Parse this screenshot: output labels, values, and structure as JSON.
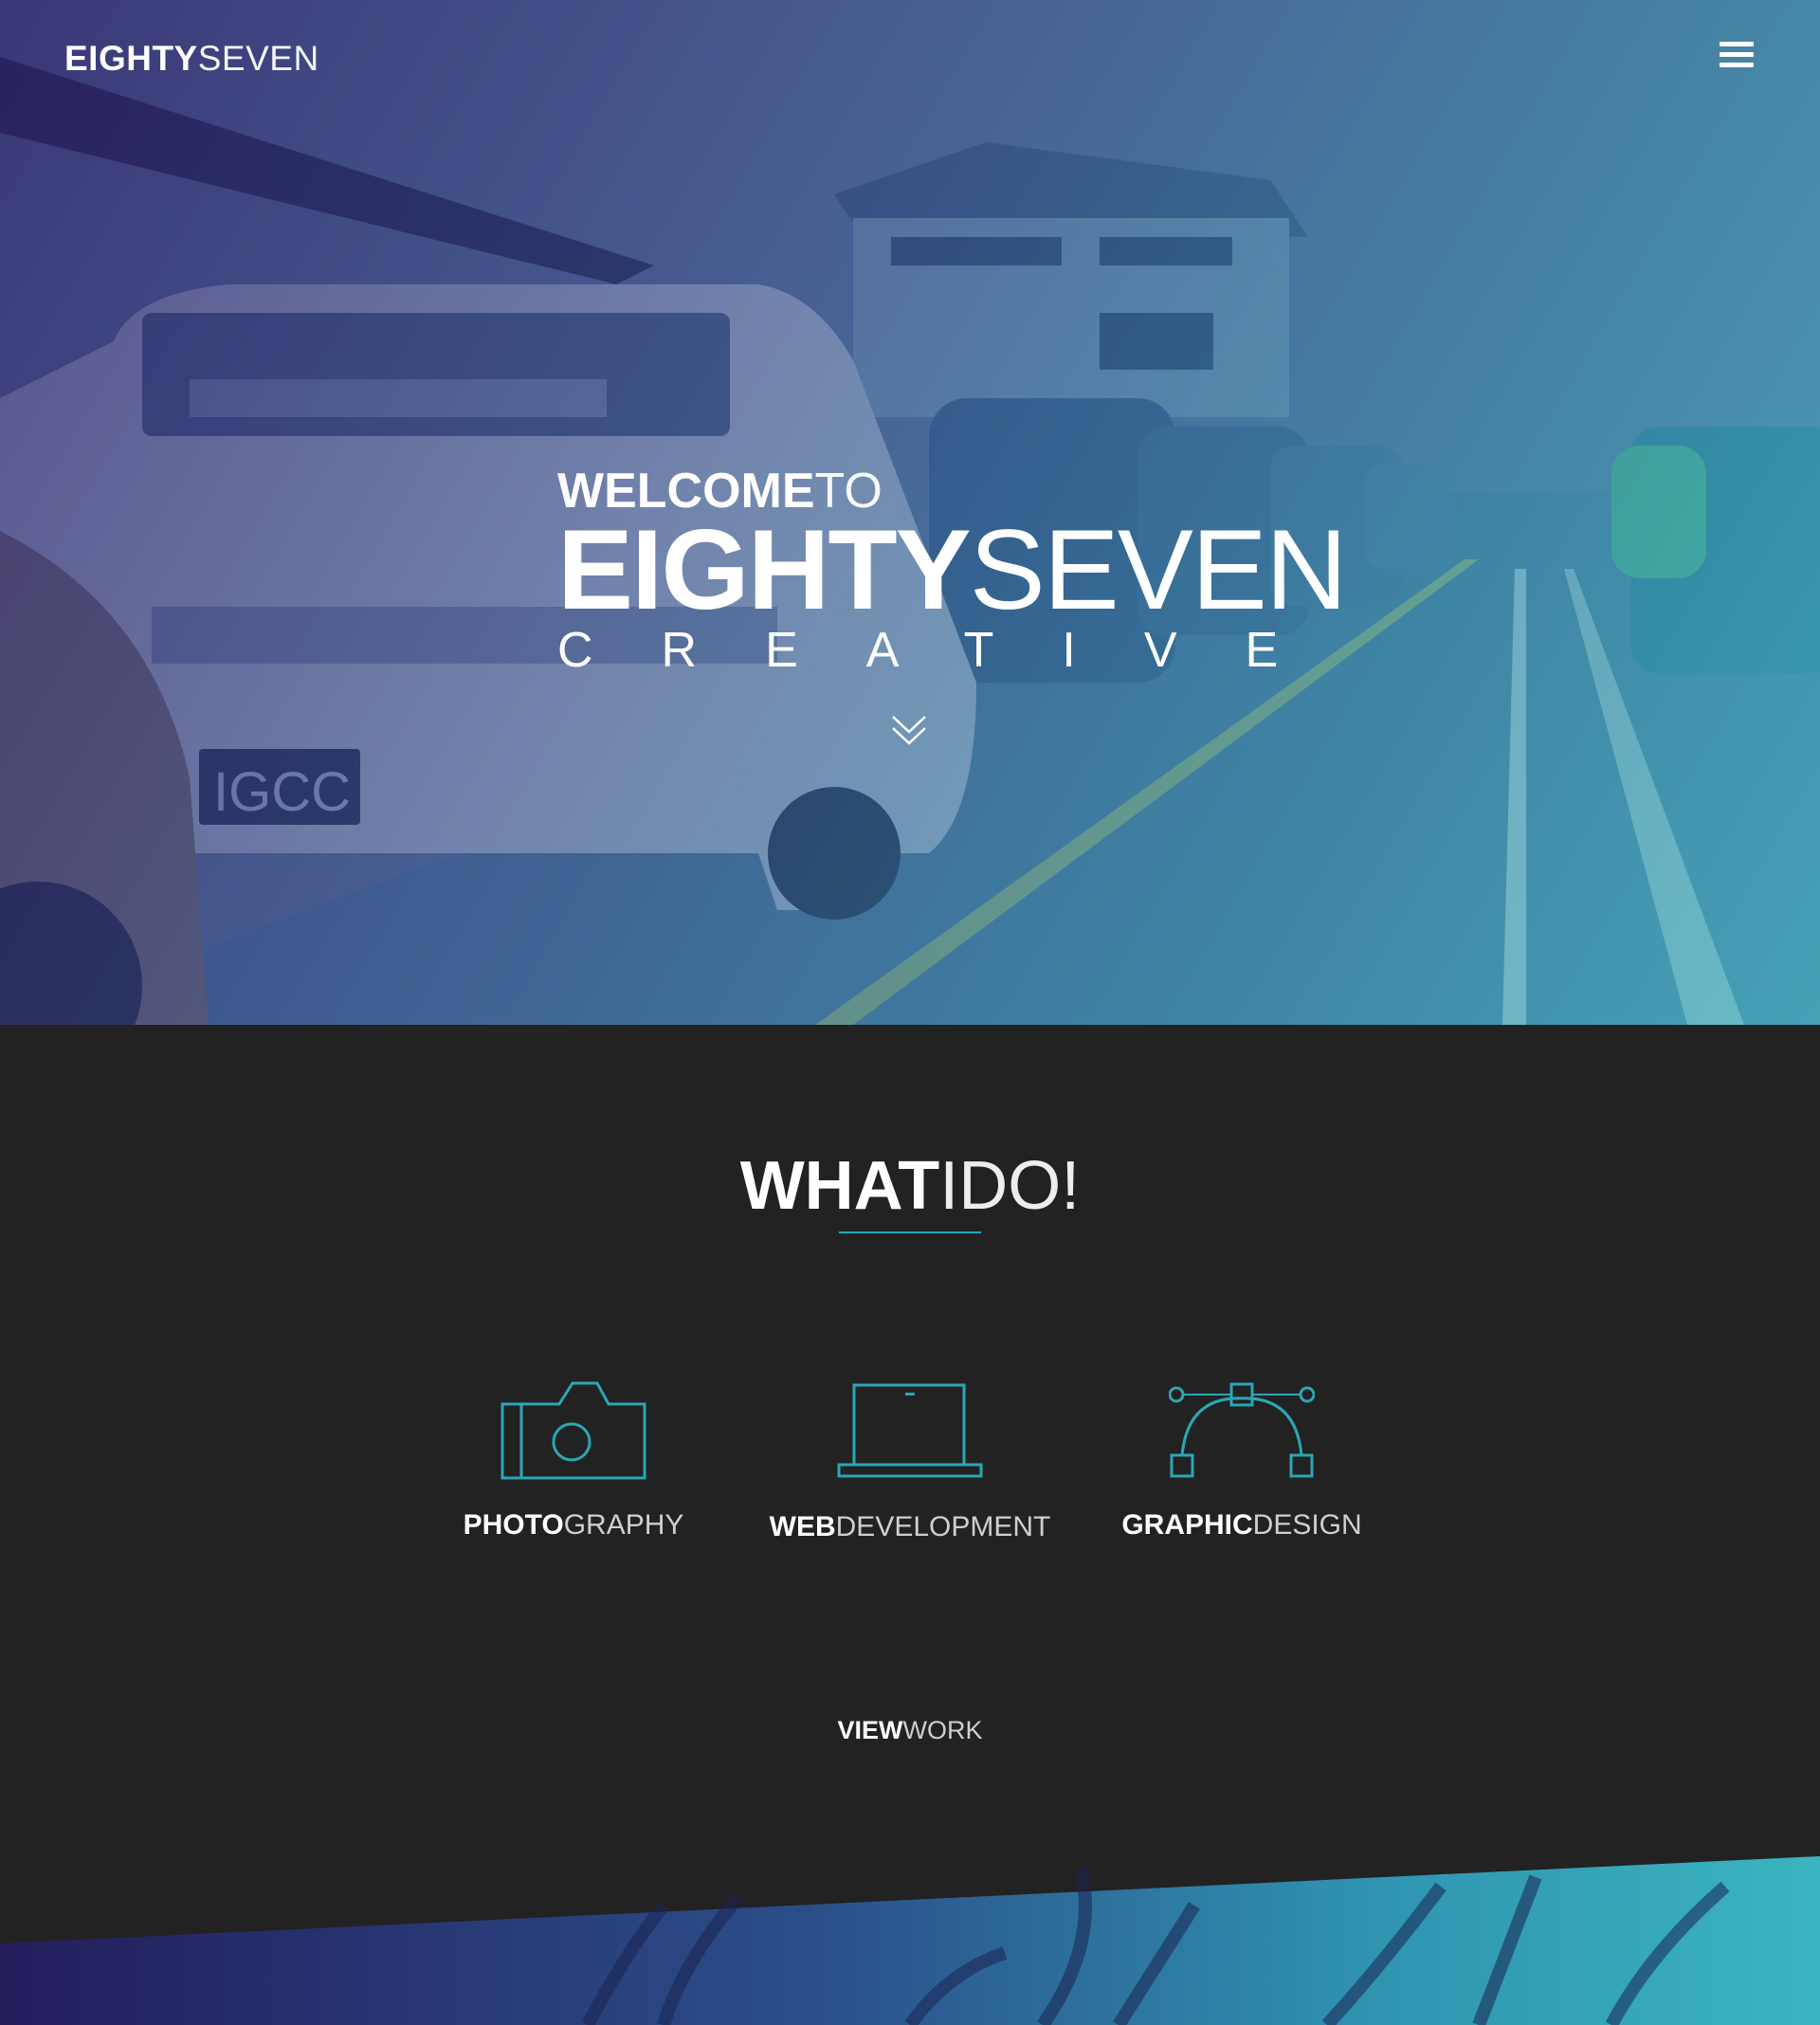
{
  "header": {
    "logo_bold": "EIGHTY",
    "logo_light": "SEVEN",
    "menu_icon": "hamburger-menu-icon"
  },
  "hero": {
    "welcome_bold": "WELCOME",
    "welcome_light": "TO",
    "brand_bold": "EIGHTY",
    "brand_light": "SEVEN",
    "tagline": "CREATIVE",
    "scroll_icon": "double-chevron-down-icon"
  },
  "services": {
    "title_bold": "WHAT",
    "title_light": "IDO!",
    "items": [
      {
        "bold": "PHOTO",
        "light": "GRAPHY",
        "icon": "camera-icon"
      },
      {
        "bold": "WEB",
        "light": "DEVELOPMENT",
        "icon": "laptop-icon"
      },
      {
        "bold": "GRAPHIC",
        "light": "DESIGN",
        "icon": "bezier-curve-icon"
      }
    ],
    "cta_bold": "VIEW",
    "cta_light": "WORK"
  },
  "colors": {
    "accent": "#2aa7b5",
    "dark_bg": "#222222",
    "hero_purple": "#2a2569",
    "hero_teal": "#38b9c0"
  }
}
